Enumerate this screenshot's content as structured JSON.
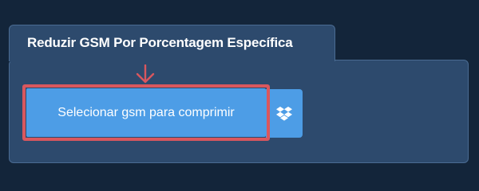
{
  "panel": {
    "title": "Reduzir GSM Por Porcentagem Específica"
  },
  "upload": {
    "select_label": "Selecionar gsm para comprimir",
    "dropbox_icon": "dropbox-icon",
    "arrow_icon": "arrow-down-icon"
  },
  "colors": {
    "background": "#13253a",
    "panel": "#2d4a6d",
    "button": "#4d9de6",
    "highlight": "#d9575e"
  }
}
